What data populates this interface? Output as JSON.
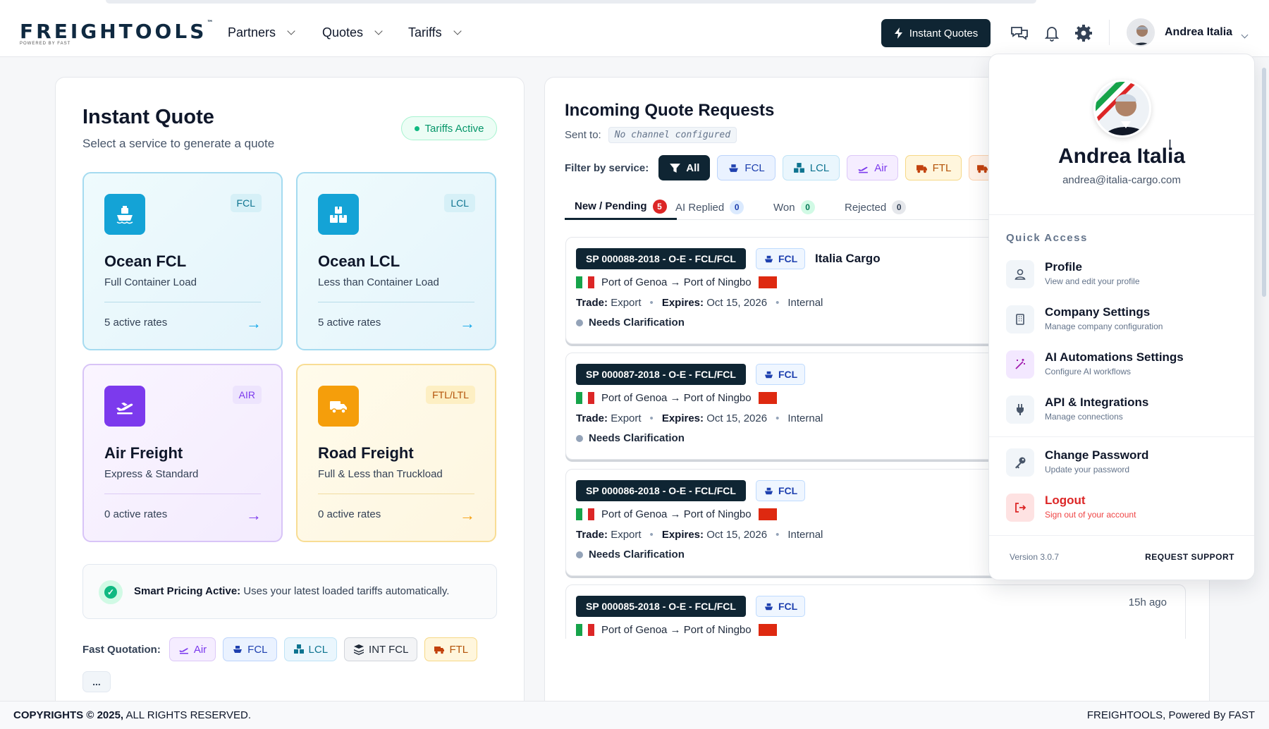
{
  "brand": {
    "logo": "FREIGHTOOLS",
    "tm": "™",
    "tagline": "POWERED BY FAST"
  },
  "nav": [
    {
      "label": "Partners"
    },
    {
      "label": "Quotes"
    },
    {
      "label": "Tariffs"
    }
  ],
  "header": {
    "instant_quotes": "Instant Quotes",
    "user_name": "Andrea Italia",
    "icons": [
      "chat-icon",
      "bell-icon",
      "gear-icon"
    ]
  },
  "instant_quote": {
    "title": "Instant Quote",
    "subtitle": "Select a service to generate a quote",
    "status_badge": "Tariffs Active",
    "services": [
      {
        "name": "Ocean FCL",
        "tag": "FCL",
        "description": "Full Container Load",
        "rates": "5 active rates",
        "icon": "ship-icon"
      },
      {
        "name": "Ocean LCL",
        "tag": "LCL",
        "description": "Less than Container Load",
        "rates": "5 active rates",
        "icon": "boxes-icon"
      },
      {
        "name": "Air Freight",
        "tag": "AIR",
        "description": "Express & Standard",
        "rates": "0 active rates",
        "icon": "plane-icon"
      },
      {
        "name": "Road Freight",
        "tag": "FTL/LTL",
        "description": "Full & Less than Truckload",
        "rates": "0 active rates",
        "icon": "truck-icon"
      }
    ],
    "smart_pricing": {
      "bold": "Smart Pricing Active:",
      "text": " Uses your latest loaded tariffs automatically."
    },
    "fast_quotation": {
      "label": "Fast Quotation:",
      "chips": [
        "Air",
        "FCL",
        "LCL",
        "INT FCL",
        "FTL"
      ],
      "more": "..."
    }
  },
  "incoming": {
    "title": "Incoming Quote Requests",
    "sent_to_label": "Sent to:",
    "sent_to_value": "No channel configured",
    "filter_label": "Filter by service:",
    "filters": [
      "All",
      "FCL",
      "LCL",
      "Air",
      "FTL"
    ],
    "tabs": [
      {
        "label": "New / Pending",
        "count": "5"
      },
      {
        "label": "AI Replied",
        "count": "0"
      },
      {
        "label": "Won",
        "count": "0"
      },
      {
        "label": "Rejected",
        "count": "0"
      }
    ],
    "requests": [
      {
        "id": "SP 000088-2018 - O-E - FCL/FCL",
        "service": "FCL",
        "company": "Italia Cargo",
        "route": "Port of Genoa → Port of Ningbo",
        "trade_label": "Trade:",
        "trade": "Export",
        "expires_label": "Expires:",
        "expires": "Oct 15, 2026",
        "scope": "Internal",
        "status": "Needs Clarification",
        "ago": ""
      },
      {
        "id": "SP 000087-2018 - O-E - FCL/FCL",
        "service": "FCL",
        "company": "",
        "route": "Port of Genoa → Port of Ningbo",
        "trade_label": "Trade:",
        "trade": "Export",
        "expires_label": "Expires:",
        "expires": "Oct 15, 2026",
        "scope": "Internal",
        "status": "Needs Clarification",
        "ago": ""
      },
      {
        "id": "SP 000086-2018 - O-E - FCL/FCL",
        "service": "FCL",
        "company": "",
        "route": "Port of Genoa → Port of Ningbo",
        "trade_label": "Trade:",
        "trade": "Export",
        "expires_label": "Expires:",
        "expires": "Oct 15, 2026",
        "scope": "Internal",
        "status": "Needs Clarification",
        "ago": ""
      },
      {
        "id": "SP 000085-2018 - O-E - FCL/FCL",
        "service": "FCL",
        "company": "",
        "route": "Port of Genoa → Port of Ningbo",
        "trade_label": "Trade:",
        "trade": "Export",
        "expires_label": "Expires:",
        "expires": "Oct 15, 2026",
        "scope": "Internal",
        "status": "Needs Clarification",
        "ago": "15h ago"
      }
    ]
  },
  "dropdown": {
    "name": "Andrea Italia",
    "email": "andrea@italia-cargo.com",
    "quick_access": "Quick Access",
    "items": [
      {
        "label": "Profile",
        "sub": "View and edit your profile",
        "icon": "user-icon"
      },
      {
        "label": "Company Settings",
        "sub": "Manage company configuration",
        "icon": "building-icon"
      },
      {
        "label": "AI Automations Settings",
        "sub": "Configure AI workflows",
        "icon": "magic-wand-icon"
      },
      {
        "label": "API & Integrations",
        "sub": "Manage connections",
        "icon": "plug-icon"
      },
      {
        "label": "Change Password",
        "sub": "Update your password",
        "icon": "key-icon"
      },
      {
        "label": "Logout",
        "sub": "Sign out of your account",
        "icon": "logout-icon"
      }
    ],
    "version": "Version 3.0.7",
    "support": "REQUEST SUPPORT"
  },
  "footer": {
    "copyright_bold": "COPYRIGHTS © 2025,",
    "copyright_rest": " ALL RIGHTS RESERVED.",
    "right": "FREIGHTOOLS, Powered By FAST"
  },
  "colors": {
    "navy": "#0f2533",
    "fcl": "#0ea5e9",
    "lcl": "#0ea5e9",
    "air": "#7c3aed",
    "road": "#f59e0b",
    "logout": "#dc2626",
    "success": "#10b981"
  }
}
